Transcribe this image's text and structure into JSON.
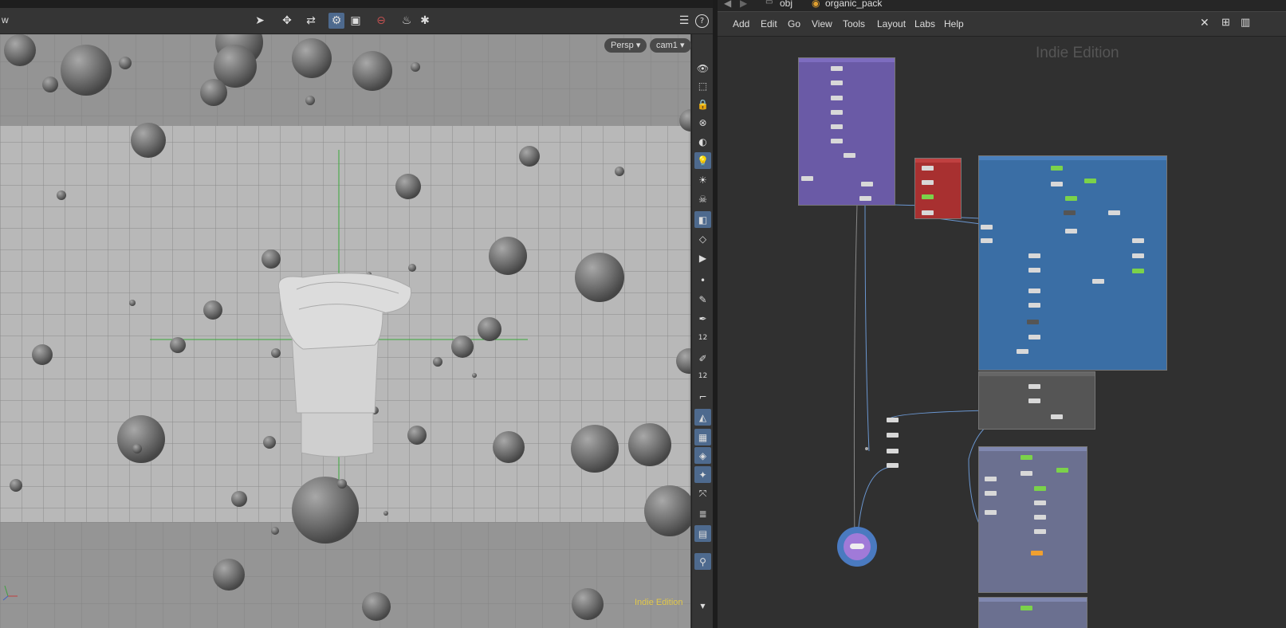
{
  "viewport": {
    "title": "w",
    "camera_menu": "Persp",
    "cam_menu": "cam1",
    "watermark": "Indie Edition",
    "toolbar_icons": [
      "select-icon",
      "transform-icon",
      "handle-icon",
      "snap-icon",
      "display-icon",
      "ghost-icon",
      "stop-icon",
      "lighting-icon",
      "render-icon"
    ],
    "side_icons": [
      "eye-icon",
      "camera-icon",
      "lock-icon",
      "visibility-icon",
      "wire-icon",
      "light-icon",
      "bulb-icon",
      "skull-icon",
      "shade-icon",
      "ghost-icon",
      "cam-icon",
      "point-icon",
      "brush-icon",
      "pen-icon",
      "guide-icon",
      "paint-icon",
      "vector-icon",
      "corner-icon",
      "snap-icon",
      "grid-icon",
      "shape-icon",
      "butterfly-icon",
      "axis-icon",
      "stack-icon",
      "window-icon",
      "pin-icon"
    ],
    "side_numbers": [
      "12",
      "12"
    ]
  },
  "network": {
    "path": [
      "obj",
      "organic_pack"
    ],
    "menu": [
      "Add",
      "Edit",
      "Go",
      "View",
      "Tools",
      "Layout",
      "Labs",
      "Help"
    ],
    "watermark": "Indie Edition",
    "colors": {
      "purple_box": "#6a5aa6",
      "red_box": "#b03030",
      "blue_box": "#3a6ea5",
      "gray_box": "#555555",
      "lavender_box": "#6b7090"
    }
  }
}
